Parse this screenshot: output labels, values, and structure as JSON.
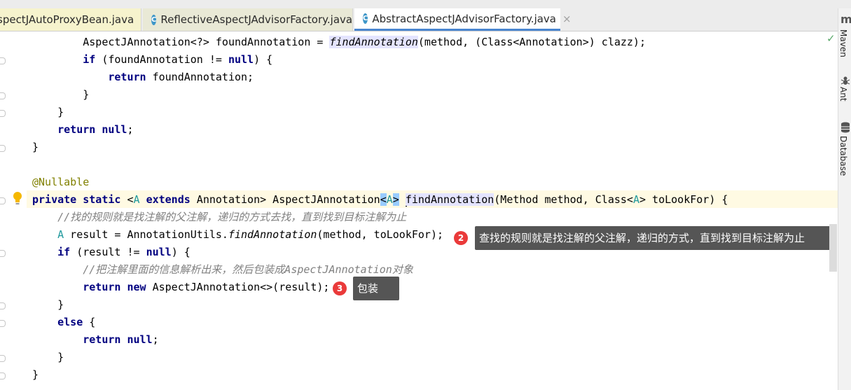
{
  "tabs": [
    {
      "label": "spectJAutoProxyBean.java",
      "active": false
    },
    {
      "label": "ReflectiveAspectJAdvisorFactory.java",
      "active": false,
      "icon": "C"
    },
    {
      "label": "AbstractAspectJAdvisorFactory.java",
      "active": true,
      "icon": "C"
    }
  ],
  "tab_close_glyph": "×",
  "right_panel": {
    "maven_logo": "m",
    "maven": "Maven",
    "ant": "Ant",
    "database": "Database"
  },
  "code": {
    "l1": {
      "a": "        AspectJAnnotation<?> foundAnnotation = ",
      "b": "findAnnotation",
      "c": "(method, (Class<Annotation>) clazz);"
    },
    "l2": {
      "a": "        ",
      "kw1": "if",
      "b": " (foundAnnotation != ",
      "kw2": "null",
      "c": ") {"
    },
    "l3": {
      "a": "            ",
      "kw": "return",
      "b": " foundAnnotation;"
    },
    "l4": "        }",
    "l5": "    }",
    "l6": {
      "a": "    ",
      "kw1": "return",
      "b": " ",
      "kw2": "null",
      "c": ";"
    },
    "l7": "}",
    "l8": "@Nullable",
    "l9": {
      "kw1": "private",
      "kw2": "static",
      "lt": "<",
      "A1": "A",
      "kw3": "extends",
      "b": " Annotation> AspectJAnnotation",
      "lt2": "<",
      "A2": "A",
      "gt2": ">",
      "c": "findAnnotation",
      "d": "(Method method, Class<",
      "A3": "A",
      "e": "> toLookFor) {"
    },
    "l10": "    //找的规则就是找注解的父注解，递归的方式去找，直到找到目标注解为止",
    "l11": {
      "a": "    ",
      "A": "A",
      "b": " result = AnnotationUtils.",
      "c": "findAnnotation",
      "d": "(method, toLookFor);"
    },
    "l12": {
      "a": "    ",
      "kw1": "if",
      "b": " (result != ",
      "kw2": "null",
      "c": ") {"
    },
    "l13": "        //把注解里面的信息解析出来，然后包装成AspectJAnnotation对象",
    "l14": {
      "a": "        ",
      "kw1": "return",
      "b": " ",
      "kw2": "new",
      "c": " AspectJAnnotation<>(result);"
    },
    "l15": "    }",
    "l16": {
      "a": "    ",
      "kw": "else",
      "b": " {"
    },
    "l17": {
      "a": "        ",
      "kw1": "return",
      "b": " ",
      "kw2": "null",
      "c": ";"
    },
    "l18": "    }",
    "l19": "}"
  },
  "annotations": [
    {
      "number": "2",
      "text": "查找的规则就是找注解的父注解，递归的方式，直到找到目标注解为止"
    },
    {
      "number": "3",
      "text": "包装"
    }
  ],
  "colors": {
    "keyword": "#000080",
    "annotation": "#808000",
    "type_param": "#20999d",
    "comment": "#808080",
    "callout_bg": "#555555",
    "badge": "#ea3a3a"
  }
}
